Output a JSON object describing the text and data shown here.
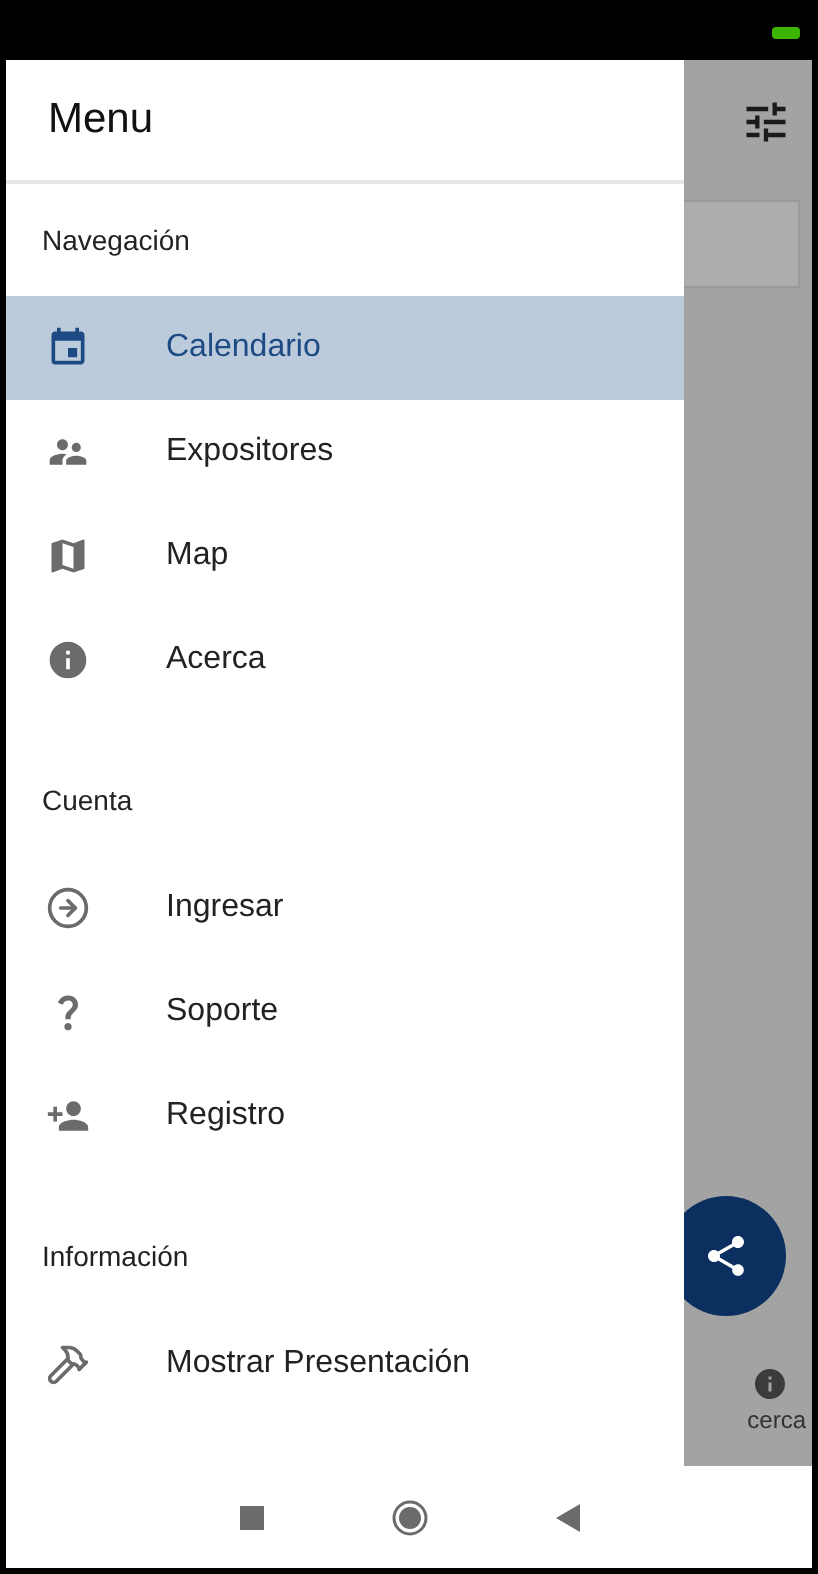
{
  "drawer": {
    "title": "Menu",
    "sections": [
      {
        "title": "Navegación",
        "items": [
          {
            "label": "Calendario",
            "selected": true
          },
          {
            "label": "Expositores",
            "selected": false
          },
          {
            "label": "Map",
            "selected": false
          },
          {
            "label": "Acerca",
            "selected": false
          }
        ]
      },
      {
        "title": "Cuenta",
        "items": [
          {
            "label": "Ingresar",
            "selected": false
          },
          {
            "label": "Soporte",
            "selected": false
          },
          {
            "label": "Registro",
            "selected": false
          }
        ]
      },
      {
        "title": "Información",
        "items": [
          {
            "label": "Mostrar Presentación",
            "selected": false
          }
        ]
      }
    ]
  },
  "background": {
    "bottom_tab": "cerca"
  }
}
